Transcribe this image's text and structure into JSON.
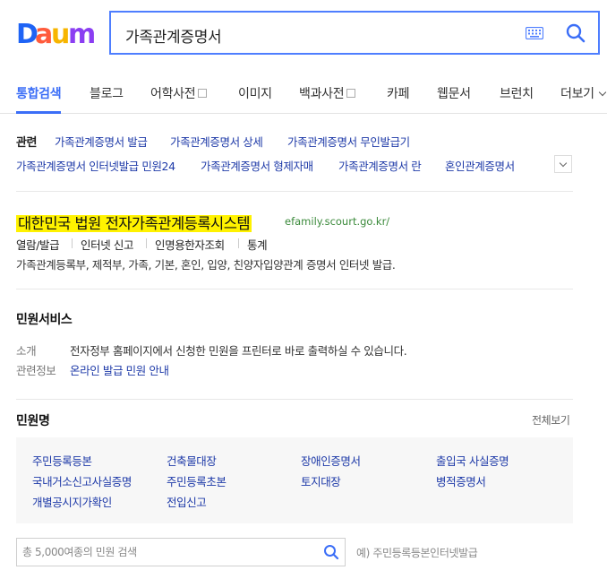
{
  "header": {
    "logo_text": "Daum",
    "logo_colors": [
      "#1e63f5",
      "#ff5b3c",
      "#f7b500",
      "#22b14c",
      "#8b3ef2"
    ],
    "query": "가족관계증명서",
    "accent": "#4e7eff"
  },
  "nav": {
    "tabs": [
      {
        "label": "통합검색",
        "active": true
      },
      {
        "label": "블로그"
      },
      {
        "label": "어학사전",
        "checkbox": true
      },
      {
        "label": "이미지"
      },
      {
        "label": "백과사전",
        "checkbox": true
      },
      {
        "label": "카페"
      },
      {
        "label": "웹문서"
      },
      {
        "label": "브런치"
      },
      {
        "label": "더보기"
      }
    ]
  },
  "related": {
    "title": "관련",
    "row1": [
      "가족관계증명서 발급",
      "가족관계증명서 상세",
      "가족관계증명서 무인발급기"
    ],
    "row2": [
      "가족관계증명서 인터넷발급 민원24",
      "가족관계증명서 형제자매",
      "가족관계증명서 란",
      "혼인관계증명서"
    ]
  },
  "site": {
    "title": "대한민국 법원 전자가족관계등록시스템",
    "url": "efamily.scourt.go.kr/",
    "sublinks": [
      "열람/발급",
      "인터넷 신고",
      "인명용한자조회",
      "통계"
    ],
    "description": "가족관계등록부, 제적부, 가족, 기본, 혼인, 입양, 친양자입양관계 증명서 인터넷 발급."
  },
  "service": {
    "title": "민원서비스",
    "intro_label": "소개",
    "intro_text": "전자정부 홈페이지에서 신청한 민원을 프린터로 바로 출력하실 수 있습니다.",
    "related_label": "관련정보",
    "related_link": "온라인 발급 민원 안내"
  },
  "civil": {
    "title": "민원명",
    "view_all": "전체보기",
    "items": [
      "주민등록등본",
      "건축물대장",
      "장애인증명서",
      "출입국 사실증명",
      "국내거소신고사실증명",
      "주민등록초본",
      "토지대장",
      "병적증명서",
      "개별공시지가확인",
      "전입신고"
    ]
  },
  "sub_search": {
    "placeholder": "총 5,000여종의 민원 검색",
    "example": "예) 주민등록등본인터넷발급"
  }
}
